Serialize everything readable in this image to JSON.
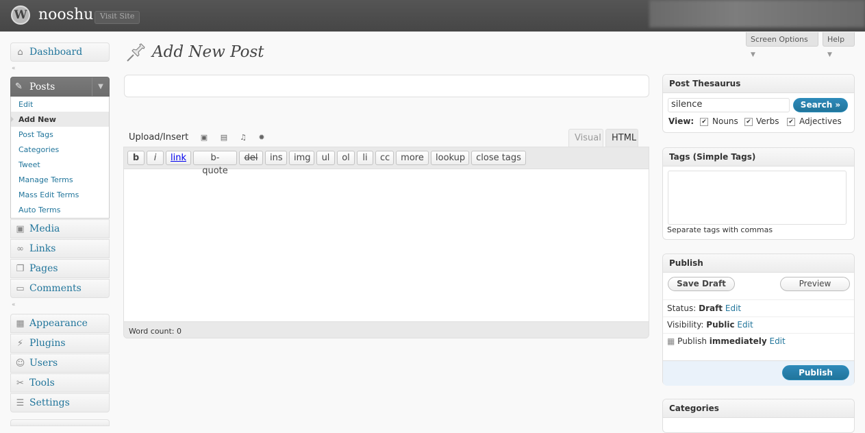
{
  "header": {
    "logo_glyph": "W",
    "site_title": "nooshu",
    "visit_site": "Visit Site"
  },
  "screen_meta": {
    "screen_options": "Screen Options",
    "help": "Help",
    "arrow": "▼"
  },
  "menu": {
    "dashboard": "Dashboard",
    "posts": "Posts",
    "posts_sub": [
      "Edit",
      "Add New",
      "Post Tags",
      "Categories",
      "Tweet",
      "Manage Terms",
      "Mass Edit Terms",
      "Auto Terms"
    ],
    "media": "Media",
    "links": "Links",
    "pages": "Pages",
    "comments": "Comments",
    "appearance": "Appearance",
    "plugins": "Plugins",
    "users": "Users",
    "tools": "Tools",
    "settings": "Settings",
    "collapse_glyph": "«"
  },
  "page": {
    "title": "Add New Post"
  },
  "editor": {
    "upload_insert": "Upload/Insert",
    "tab_visual": "Visual",
    "tab_html": "HTML",
    "quicktags": [
      "b",
      "i",
      "link",
      "b-quote",
      "del",
      "ins",
      "img",
      "ul",
      "ol",
      "li",
      "cc",
      "more",
      "lookup",
      "close tags"
    ],
    "word_count": "Word count: 0"
  },
  "thesaurus": {
    "title": "Post Thesaurus",
    "value": "silence",
    "search": "Search »",
    "view_label": "View:",
    "options": [
      {
        "label": "Nouns",
        "checked": true
      },
      {
        "label": "Verbs",
        "checked": true
      },
      {
        "label": "Adjectives",
        "checked": true
      }
    ]
  },
  "tags": {
    "title": "Tags (Simple Tags)",
    "help": "Separate tags with commas"
  },
  "publish": {
    "title": "Publish",
    "save_draft": "Save Draft",
    "preview": "Preview",
    "status_label": "Status:",
    "status_value": "Draft",
    "visibility_label": "Visibility:",
    "visibility_value": "Public",
    "publish_label": "Publish",
    "publish_value": "immediately",
    "edit": "Edit",
    "publish_button": "Publish"
  },
  "categories": {
    "title": "Categories"
  }
}
